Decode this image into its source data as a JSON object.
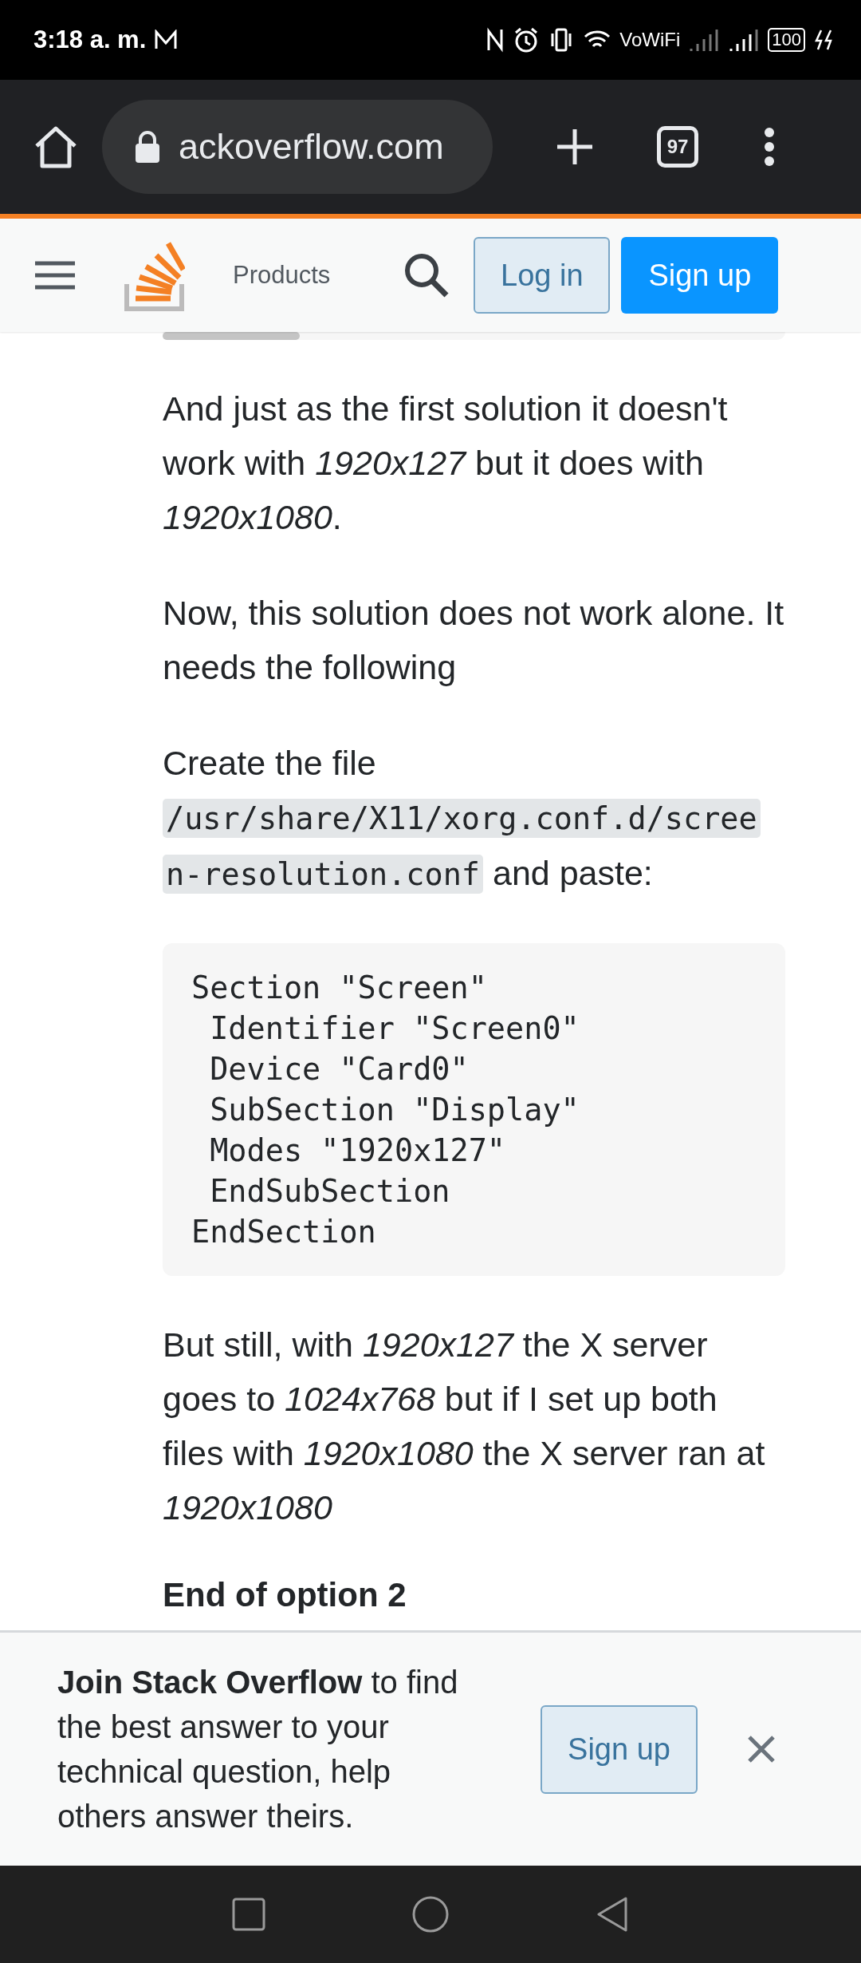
{
  "status_bar": {
    "time": "3:18 a. m.",
    "network": "VoWiFi",
    "battery": "100"
  },
  "browser": {
    "url": "ackoverflow.com",
    "tab_count": "97"
  },
  "site_header": {
    "nav_label": "Products",
    "login": "Log in",
    "signup": "Sign up"
  },
  "content": [
    {
      "kind": "paragraph",
      "text": "And just as the first solution it doesn't work with *1920x127* but it does with *1920x1080*."
    },
    {
      "kind": "paragraph",
      "text": "Now, this solution does not work alone. It needs the following"
    },
    {
      "kind": "mixed",
      "parts": [
        {
          "kind": "text",
          "text": "Create the file "
        },
        {
          "kind": "code",
          "text": "/usr/share/X11/xorg.conf.d/scree"
        },
        {
          "kind": "code",
          "text": "n-resolution.conf"
        },
        {
          "kind": "text",
          "text": " and paste:"
        }
      ]
    },
    {
      "kind": "code_block",
      "lines": [
        "Section \"Screen\"",
        " Identifier \"Screen0\"",
        " Device \"Card0\"",
        " SubSection \"Display\"",
        " Modes \"1920x127\"",
        " EndSubSection",
        "EndSection"
      ]
    },
    {
      "kind": "paragraph",
      "text": "But still, with *1920x127* the X server goes to *1024x768* but if I set up both files with *1920x1080* the X server ran at *1920x1080*"
    },
    {
      "kind": "heading",
      "text": "End of option 2"
    }
  ],
  "banner": {
    "text": "**Join Stack Overflow** to find the best answer to your technical question, help others answer theirs.",
    "button": "Sign up"
  }
}
